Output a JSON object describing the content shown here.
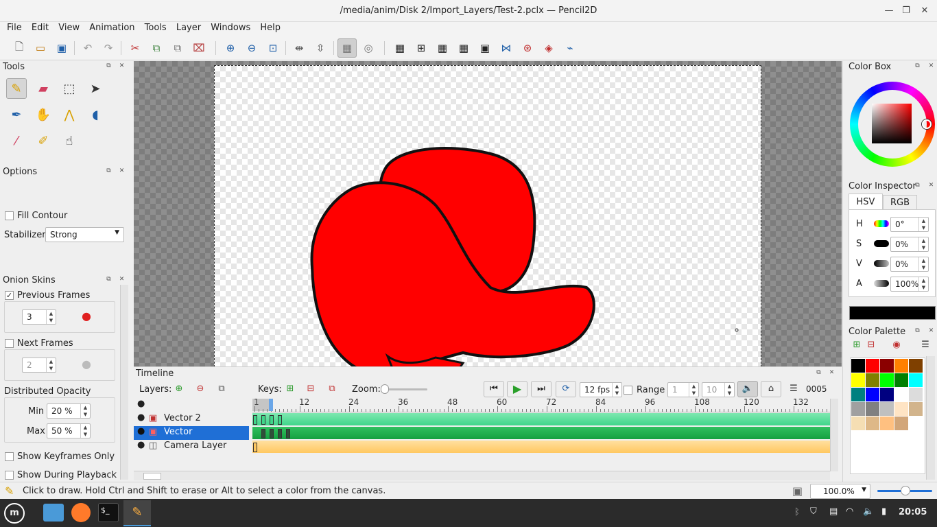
{
  "window": {
    "title": "/media/anim/Disk 2/Import_Layers/Test-2.pclx — Pencil2D"
  },
  "menu": [
    "File",
    "Edit",
    "View",
    "Animation",
    "Tools",
    "Layer",
    "Windows",
    "Help"
  ],
  "toolbar_icons": [
    "new-file-icon",
    "open-folder-icon",
    "save-icon",
    "undo-icon",
    "redo-icon",
    "cut-icon",
    "copy-icon",
    "paste-icon",
    "clear-icon",
    "zoom-in-icon",
    "zoom-out-icon",
    "zoom-fit-icon",
    "flip-horizontal-icon",
    "flip-vertical-icon",
    "preview-icon",
    "onion-skin-icon",
    "grid-icon",
    "center-icon",
    "thirds-icon",
    "golden-ratio-icon",
    "safe-area-icon",
    "flip-x-icon",
    "camera-path-icon",
    "color-wheel-icon",
    "overlay-icon"
  ],
  "tools": {
    "title": "Tools",
    "items": [
      "pencil-icon",
      "eraser-icon",
      "select-icon",
      "pointer-icon",
      "pen-icon",
      "hand-icon",
      "polyline-icon",
      "bucket-icon",
      "eyedropper-icon",
      "brush-icon",
      "smudge-icon"
    ]
  },
  "options": {
    "title": "Options",
    "fill_contour": "Fill Contour",
    "stabilizer_label": "Stabilizer",
    "stabilizer_value": "Strong"
  },
  "onion": {
    "title": "Onion Skins",
    "previous_frames": "Previous Frames",
    "previous_value": "3",
    "next_frames": "Next Frames",
    "next_value": "2",
    "distributed": "Distributed Opacity",
    "min_label": "Min",
    "min_value": "20 %",
    "max_label": "Max",
    "max_value": "50 %",
    "show_keyframes_only": "Show Keyframes Only",
    "show_during_playback": "Show During Playback"
  },
  "timeline": {
    "title": "Timeline",
    "layers_label": "Layers:",
    "keys_label": "Keys:",
    "zoom_label": "Zoom:",
    "fps": "12 fps",
    "range_label": "Range",
    "range_start": "1",
    "range_end": "10",
    "frame_counter": "0005",
    "ruler": [
      "1",
      "12",
      "24",
      "36",
      "48",
      "60",
      "72",
      "84",
      "96",
      "108",
      "120",
      "132"
    ],
    "current_frame": 5,
    "layers": [
      {
        "name": "",
        "type": "header"
      },
      {
        "name": "Vector 2",
        "type": "vector",
        "keys": [
          1,
          3,
          5,
          7
        ]
      },
      {
        "name": "Vector",
        "type": "vector",
        "keys": [
          3,
          5,
          7,
          9
        ]
      },
      {
        "name": "Camera Layer",
        "type": "camera",
        "keys": [
          1
        ]
      }
    ]
  },
  "color_box": {
    "title": "Color Box"
  },
  "color_inspector": {
    "title": "Color Inspector",
    "tab_hsv": "HSV",
    "tab_rgb": "RGB",
    "h_label": "H",
    "h_value": "0°",
    "s_label": "S",
    "s_value": "0%",
    "v_label": "V",
    "v_value": "0%",
    "a_label": "A",
    "a_value": "100%",
    "current_color": "#000000"
  },
  "color_palette": {
    "title": "Color Palette",
    "colors": [
      "#000000",
      "#ff0000",
      "#8b0000",
      "#ff8000",
      "#7f4000",
      "#ffff00",
      "#808000",
      "#00ff00",
      "#008000",
      "#00ffff",
      "#008080",
      "#0000ff",
      "#000080",
      "#ffffff",
      "#dcdcdc",
      "#a0a0a0",
      "#808080",
      "#c0c0c0",
      "#ffe4c4",
      "#d2b48c",
      "#f5deb3",
      "#deb887",
      "#ffc080",
      "#d2a679"
    ]
  },
  "status": {
    "message": "Click to draw. Hold Ctrl and Shift to erase or Alt to select a color from the canvas.",
    "zoom": "100.0%"
  },
  "taskbar": {
    "apps": [
      "mint-menu-icon",
      "files-icon",
      "firefox-icon",
      "terminal-icon",
      "pencil2d-icon"
    ],
    "clock": "20:05"
  },
  "colors": {
    "accent": "#1f6fd6",
    "shape_fill": "#ff0000",
    "vector2_track": "#3fd68a",
    "vector_track": "#1fae4a",
    "camera_track": "#ffd27a"
  }
}
